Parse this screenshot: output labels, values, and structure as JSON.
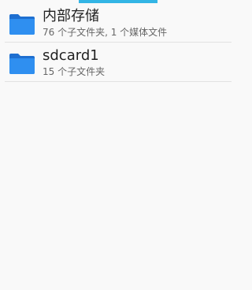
{
  "colors": {
    "accent": "#33b5e5",
    "folder_front": "#2f8ff0",
    "folder_back": "#1f6fd0",
    "title_text": "#222222",
    "subtitle_text": "#666666",
    "divider": "#e2e2e2",
    "background": "#f9f9f9"
  },
  "storage": {
    "items": [
      {
        "icon": "folder-icon",
        "title": "内部存储",
        "subtitle": "76 个子文件夹, 1 个媒体文件"
      },
      {
        "icon": "folder-icon",
        "title": "sdcard1",
        "subtitle": "15 个子文件夹"
      }
    ]
  }
}
